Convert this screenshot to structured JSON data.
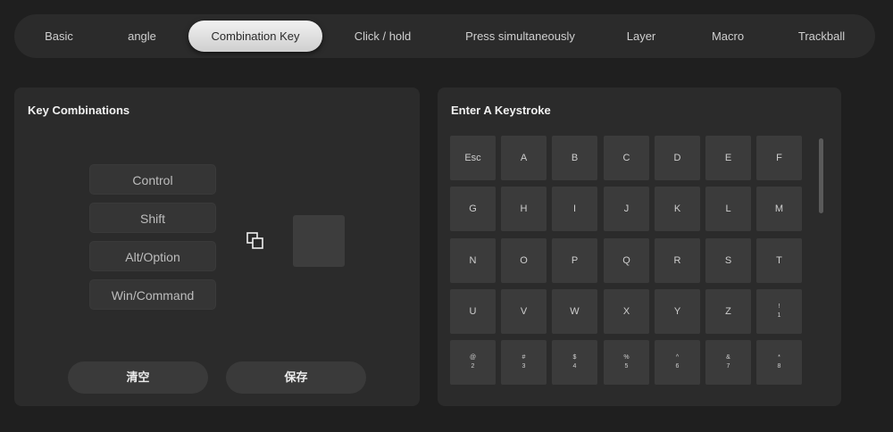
{
  "tabs": [
    {
      "label": "Basic",
      "active": false
    },
    {
      "label": "angle",
      "active": false
    },
    {
      "label": "Combination Key",
      "active": true
    },
    {
      "label": "Click / hold",
      "active": false
    },
    {
      "label": "Press simultaneously",
      "active": false
    },
    {
      "label": "Layer",
      "active": false
    },
    {
      "label": "Macro",
      "active": false
    },
    {
      "label": "Trackball",
      "active": false
    }
  ],
  "left_panel": {
    "title": "Key Combinations",
    "modifiers": [
      "Control",
      "Shift",
      "Alt/Option",
      "Win/Command"
    ],
    "combine_icon": "combine-squares-icon",
    "clear_label": "清空",
    "save_label": "保存"
  },
  "right_panel": {
    "title": "Enter A Keystroke",
    "keys": [
      {
        "main": "Esc"
      },
      {
        "main": "A"
      },
      {
        "main": "B"
      },
      {
        "main": "C"
      },
      {
        "main": "D"
      },
      {
        "main": "E"
      },
      {
        "main": "F"
      },
      {
        "main": "G"
      },
      {
        "main": "H"
      },
      {
        "main": "I"
      },
      {
        "main": "J"
      },
      {
        "main": "K"
      },
      {
        "main": "L"
      },
      {
        "main": "M"
      },
      {
        "main": "N"
      },
      {
        "main": "O"
      },
      {
        "main": "P"
      },
      {
        "main": "Q"
      },
      {
        "main": "R"
      },
      {
        "main": "S"
      },
      {
        "main": "T"
      },
      {
        "main": "U"
      },
      {
        "main": "V"
      },
      {
        "main": "W"
      },
      {
        "main": "X"
      },
      {
        "main": "Y"
      },
      {
        "main": "Z"
      },
      {
        "top": "!",
        "bot": "1"
      },
      {
        "top": "@",
        "bot": "2"
      },
      {
        "top": "#",
        "bot": "3"
      },
      {
        "top": "$",
        "bot": "4"
      },
      {
        "top": "%",
        "bot": "5"
      },
      {
        "top": "^",
        "bot": "6"
      },
      {
        "top": "&",
        "bot": "7"
      },
      {
        "top": "*",
        "bot": "8"
      }
    ]
  },
  "colors": {
    "background": "#1f1f1f",
    "panel": "#2b2b2b",
    "key": "#3b3b3b",
    "active_tab": "#e6e6e6"
  }
}
